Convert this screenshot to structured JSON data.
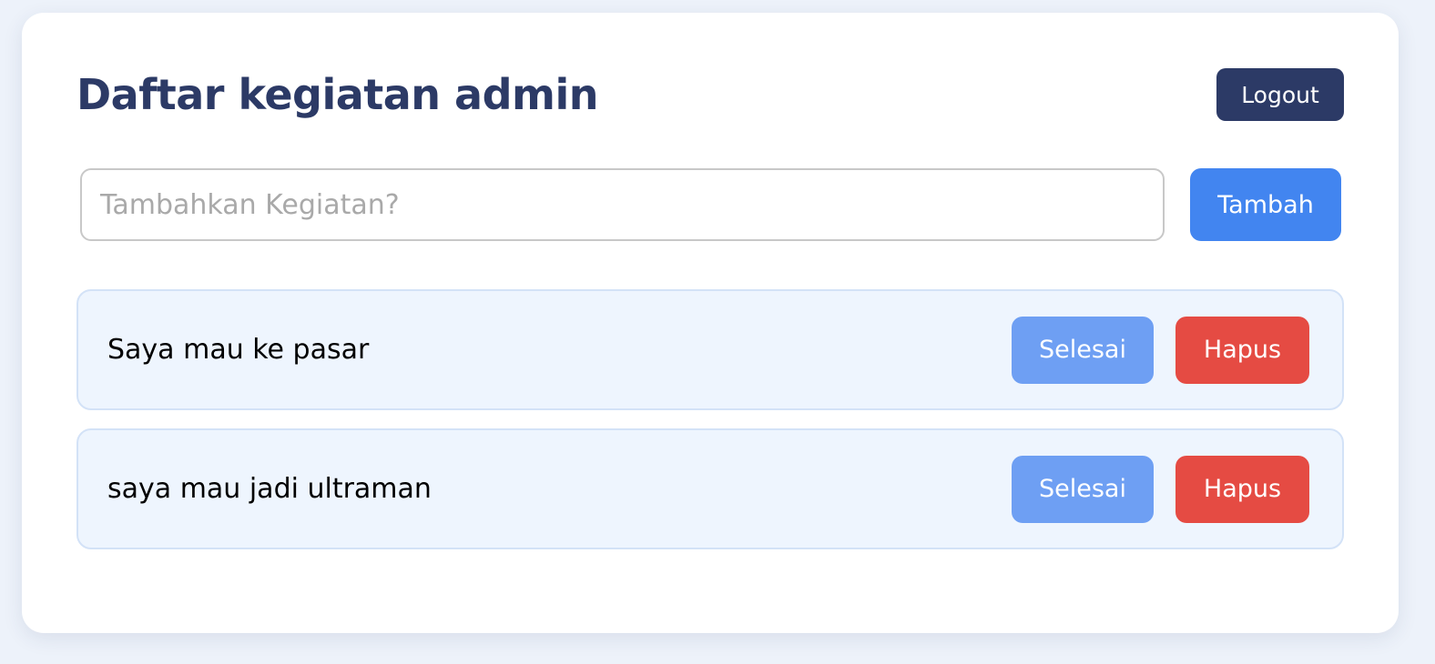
{
  "header": {
    "title": "Daftar kegiatan admin",
    "logout_label": "Logout"
  },
  "add_form": {
    "placeholder": "Tambahkan Kegiatan?",
    "value": "",
    "add_label": "Tambah"
  },
  "todos": [
    {
      "text": "Saya mau ke pasar",
      "done_label": "Selesai",
      "delete_label": "Hapus"
    },
    {
      "text": "saya mau jadi ultraman",
      "done_label": "Selesai",
      "delete_label": "Hapus"
    }
  ],
  "colors": {
    "background": "#edf2fa",
    "title": "#2c3a66",
    "logout_button": "#2c3a66",
    "add_button": "#4285f0",
    "done_button": "#6e9ff3",
    "delete_button": "#e54b43",
    "item_background": "#eef5fe"
  }
}
